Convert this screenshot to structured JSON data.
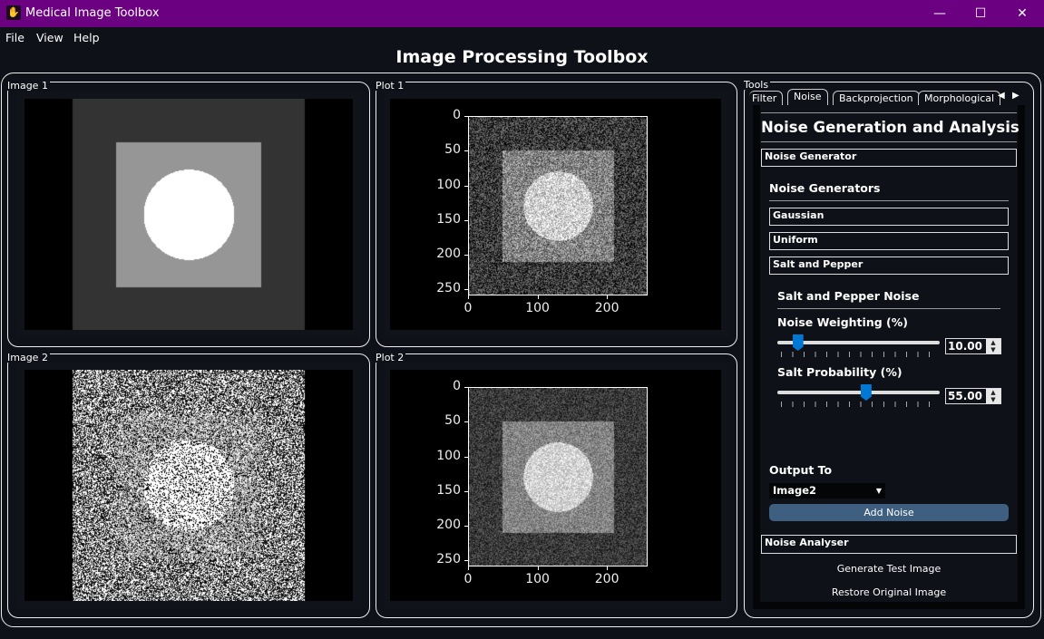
{
  "window": {
    "title": "Medical Image Toolbox",
    "controls": [
      "minimize",
      "maximize",
      "close"
    ],
    "title_color": "#6b0080"
  },
  "menu": [
    "File",
    "View",
    "Help"
  ],
  "header": {
    "title": "Image Processing Toolbox"
  },
  "panels": {
    "image1": "Image 1",
    "plot1": "Plot 1",
    "image2": "Image 2",
    "plot2": "Plot 2",
    "tools": "Tools"
  },
  "plots": {
    "x_ticks": [
      "0",
      "100",
      "200"
    ],
    "y_ticks": [
      "0",
      "50",
      "100",
      "150",
      "200",
      "250"
    ],
    "range": [
      0,
      256
    ]
  },
  "tools": {
    "tabs": [
      "Filter",
      "Noise",
      "Backprojection",
      "Morphological"
    ],
    "active_tab": "Noise",
    "heading": "Noise Generation and Analysis",
    "generator_section": "Noise Generator",
    "generators_heading": "Noise Generators",
    "generators": [
      "Gaussian",
      "Uniform",
      "Salt and Pepper"
    ],
    "sp_heading": "Salt and Pepper Noise",
    "weighting": {
      "label": "Noise Weighting (%)",
      "value": "10.00",
      "fraction": 0.1
    },
    "salt": {
      "label": "Salt Probability (%)",
      "value": "55.00",
      "fraction": 0.55
    },
    "output_label": "Output To",
    "output_value": "Image2",
    "add_noise": "Add Noise",
    "analyser_section": "Noise Analyser",
    "generate_test": "Generate Test Image",
    "restore": "Restore Original Image",
    "accent": "#0078d4",
    "button_color": "#3f5f80"
  }
}
